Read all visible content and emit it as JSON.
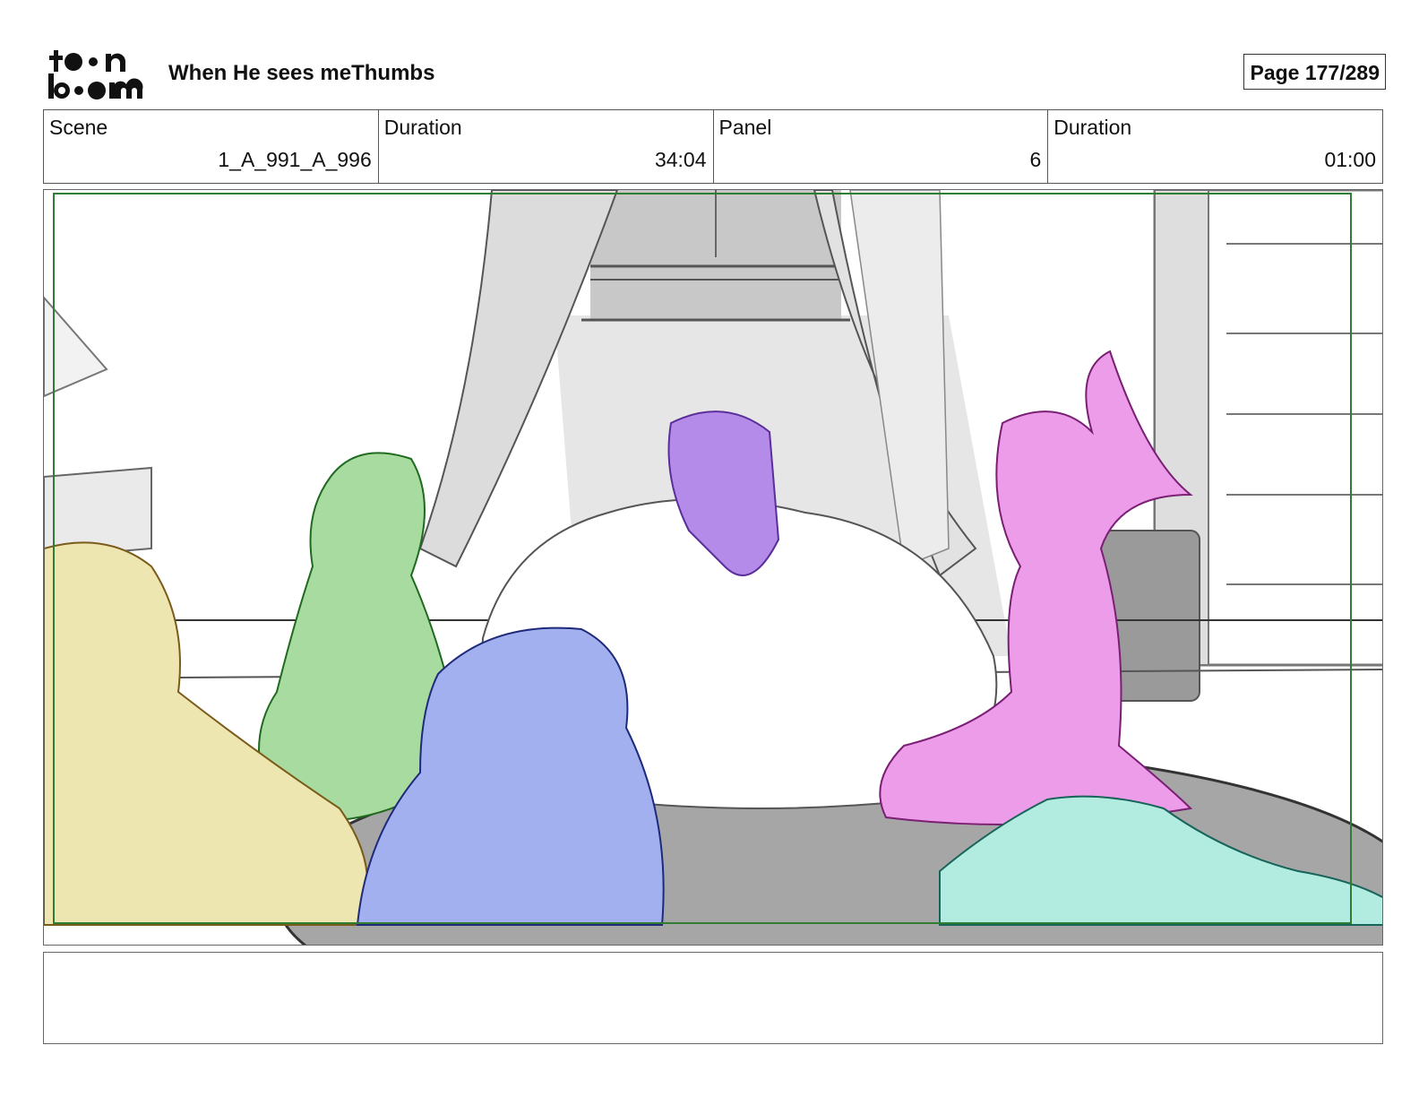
{
  "header": {
    "logo_text": "toonboom",
    "title": "When He sees meThumbs",
    "page": "Page 177/289"
  },
  "info": {
    "scene_label": "Scene",
    "scene_value": "1_A_991_A_996",
    "duration_label": "Duration",
    "duration_value": "34:04",
    "panel_label": "Panel",
    "panel_value": "6",
    "panel_duration_label": "Duration",
    "panel_duration_value": "01:00"
  },
  "notes": {
    "text": ""
  },
  "colors": {
    "frame_green": "#2e7d32",
    "yellow_character": "#ede6b0",
    "green_character": "#a8dba0",
    "blue_character": "#a3b0ef",
    "purple_character": "#b48be8",
    "pink_character": "#ec9ce8",
    "teal_character": "#b2ece0",
    "floor_gray": "#a6a6a6"
  }
}
